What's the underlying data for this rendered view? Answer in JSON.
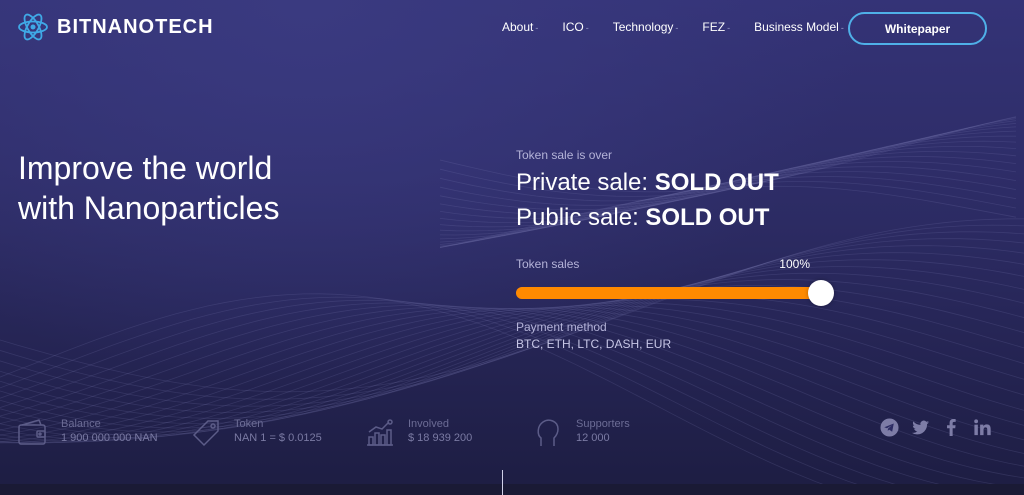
{
  "brand": {
    "name": "BITNANOTECH"
  },
  "nav": {
    "items": [
      {
        "label": "About"
      },
      {
        "label": "ICO"
      },
      {
        "label": "Technology"
      },
      {
        "label": "FEZ"
      },
      {
        "label": "Business Model"
      }
    ],
    "caret": "-",
    "whitepaper_label": "Whitepaper"
  },
  "hero": {
    "line1": "Improve the world",
    "line2": "with Nanoparticles"
  },
  "sale": {
    "status": "Token sale is over",
    "private_label": "Private sale: ",
    "private_value": "SOLD OUT",
    "public_label": "Public sale: ",
    "public_value": "SOLD OUT",
    "token_sales_label": "Token sales",
    "token_sales_percent": "100%",
    "progress_fraction": 1.0,
    "payment_label": "Payment method",
    "payment_value": "BTC, ETH, LTC, DASH, EUR"
  },
  "stats": [
    {
      "icon": "wallet-icon",
      "label": "Balance",
      "value": "1 900 000 000 NAN"
    },
    {
      "icon": "tag-icon",
      "label": "Token",
      "value": "NAN 1 = $ 0.0125"
    },
    {
      "icon": "growth-chart-icon",
      "label": "Involved",
      "value": "$ 18 939 200"
    },
    {
      "icon": "person-head-icon",
      "label": "Supporters",
      "value": "12 000"
    }
  ],
  "social": [
    "telegram-icon",
    "twitter-icon",
    "facebook-icon",
    "linkedin-icon"
  ],
  "colors": {
    "accent": "#ff8a00",
    "button_border": "#4fb0e8",
    "background": "#2b2a5e"
  }
}
